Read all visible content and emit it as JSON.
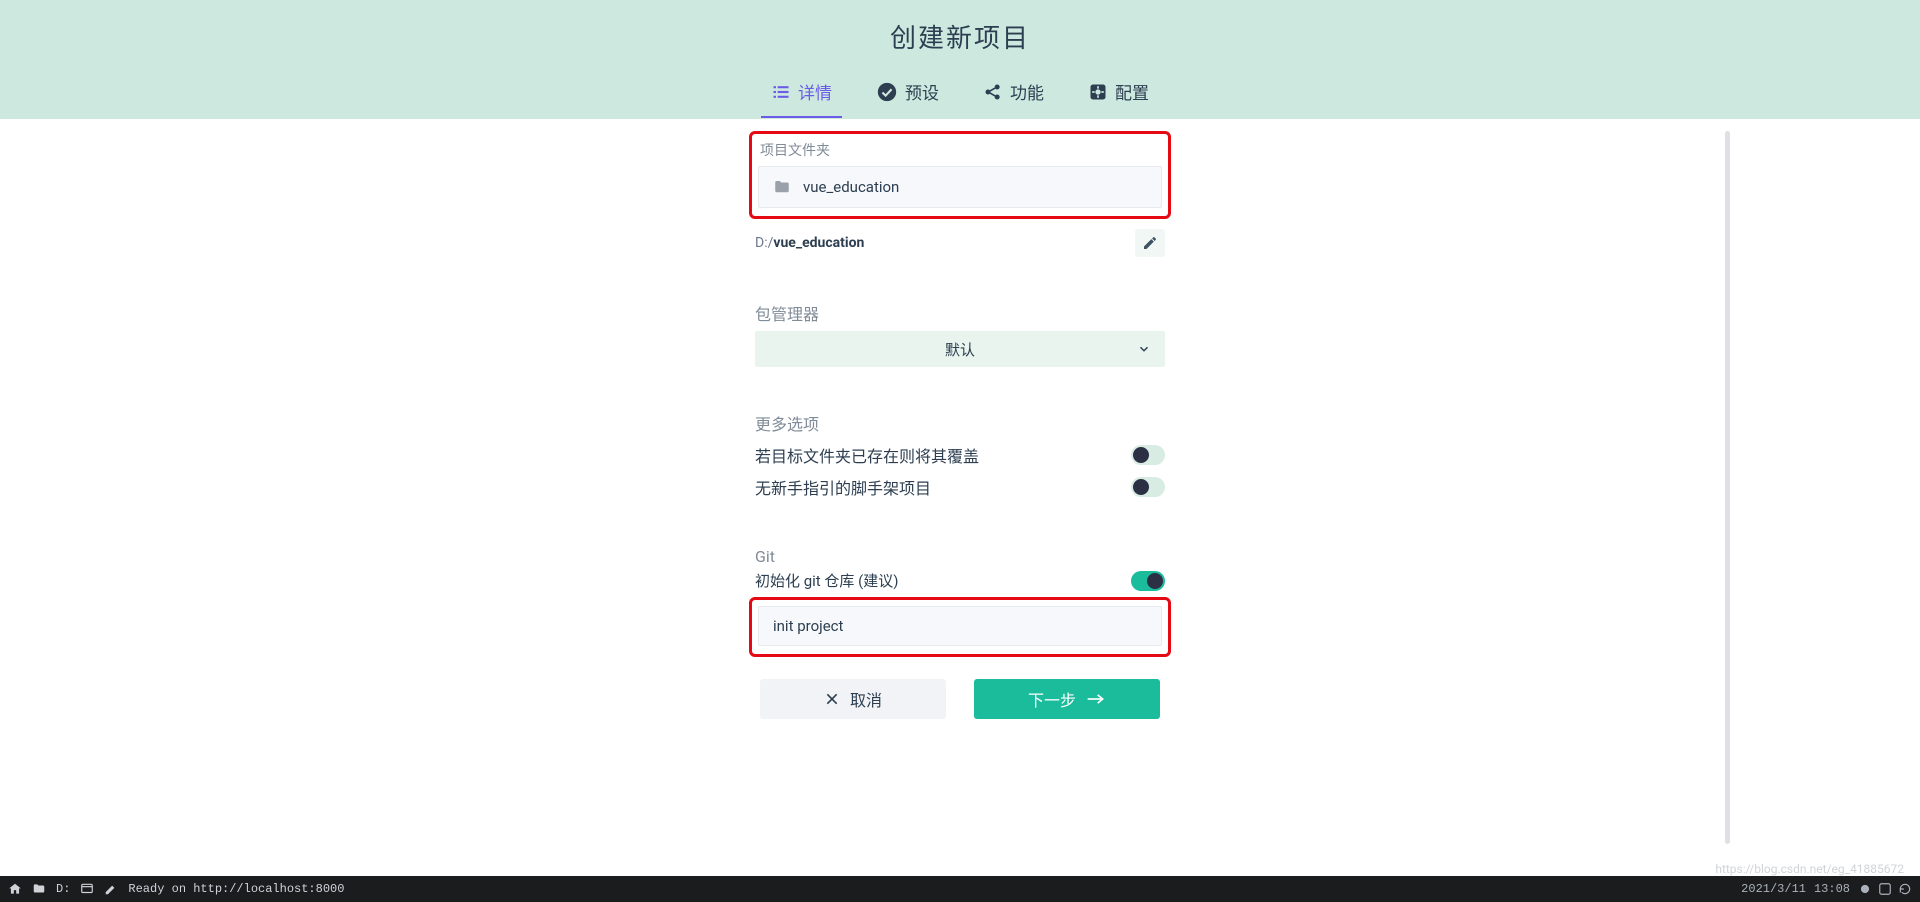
{
  "header": {
    "title": "创建新项目"
  },
  "tabs": [
    {
      "label": "详情",
      "active": true
    },
    {
      "label": "预设",
      "active": false
    },
    {
      "label": "功能",
      "active": false
    },
    {
      "label": "配置",
      "active": false
    }
  ],
  "project_folder": {
    "label": "项目文件夹",
    "value": "vue_education",
    "path_prefix": "D:/",
    "path_name": "vue_education"
  },
  "package_manager": {
    "label": "包管理器",
    "selected": "默认"
  },
  "more_options": {
    "heading": "更多选项",
    "overwrite_label": "若目标文件夹已存在则将其覆盖",
    "overwrite_on": false,
    "bare_label": "无新手指引的脚手架项目",
    "bare_on": false
  },
  "git": {
    "heading": "Git",
    "init_label": "初始化 git 仓库 (建议)",
    "init_on": true,
    "commit_msg": "init project"
  },
  "buttons": {
    "cancel": "取消",
    "next": "下一步"
  },
  "statusbar": {
    "drive": "D:",
    "ready": "Ready on http://localhost:8000",
    "datetime": "2021/3/11",
    "timehint": "13:08"
  },
  "watermark": "https://blog.csdn.net/eg_41885672"
}
